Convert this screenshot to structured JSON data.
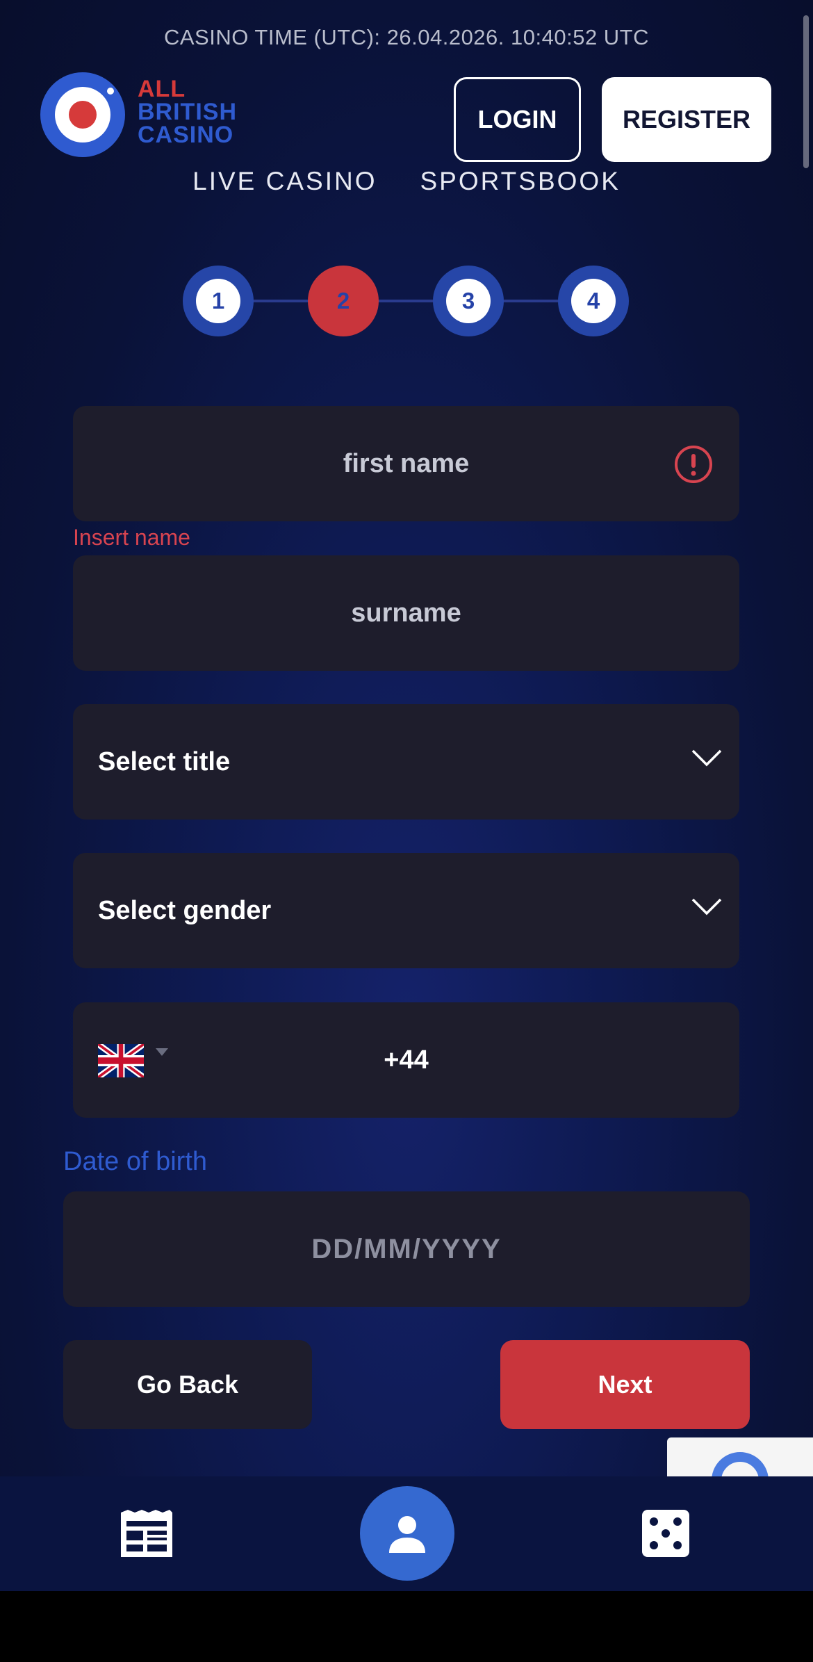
{
  "header": {
    "casino_time": "CASINO TIME (UTC): 26.04.2026. 10:40:52 UTC",
    "logo_lines": [
      "ALL",
      "BRITISH",
      "CASINO"
    ],
    "login_label": "LOGIN",
    "register_label": "REGISTER",
    "nav": [
      "LIVE CASINO",
      "SPORTSBOOK"
    ]
  },
  "stepper": {
    "steps": [
      "1",
      "2",
      "3",
      "4"
    ],
    "active_step": "2"
  },
  "form": {
    "first_name_placeholder": "first name",
    "first_name_error": "Insert name",
    "surname_placeholder": "surname",
    "title_select": "Select title",
    "gender_select": "Select gender",
    "phone_prefix": "+44",
    "dob_label": "Date of birth",
    "dob_placeholder": "DD/MM/YYYY"
  },
  "actions": {
    "back_label": "Go Back",
    "next_label": "Next"
  },
  "bottom_nav": {
    "items": [
      "newspaper-icon",
      "user-icon",
      "dice-icon"
    ]
  },
  "colors": {
    "accent_red": "#c9353c",
    "accent_blue": "#2646a8",
    "field_bg": "#1e1d2c",
    "error": "#d84450"
  }
}
